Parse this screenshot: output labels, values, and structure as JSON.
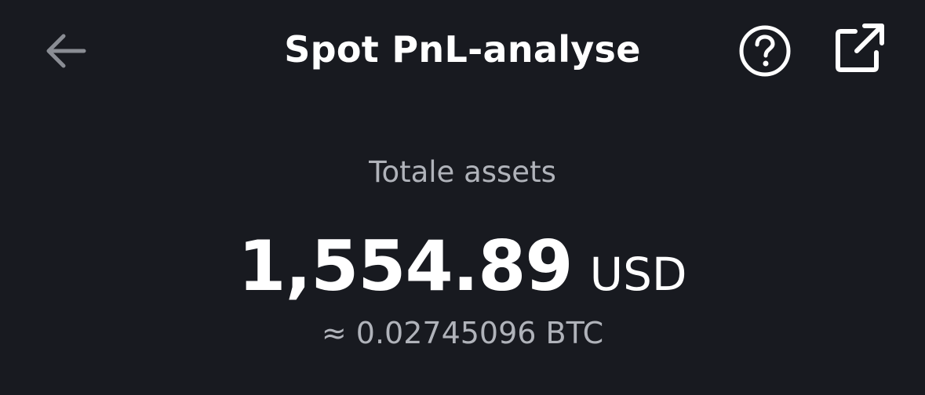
{
  "header": {
    "title": "Spot PnL-analyse",
    "back_icon": "arrow-left-icon",
    "help_icon": "question-circle-icon",
    "share_icon": "external-share-icon"
  },
  "summary": {
    "label": "Totale assets",
    "amount": "1,554.89",
    "currency": "USD",
    "btc_equivalent": "≈ 0.02745096 BTC"
  },
  "colors": {
    "background": "#181a20",
    "primary_text": "#ffffff",
    "secondary_text": "#b0b3ba",
    "back_icon": "#8a8d94"
  }
}
